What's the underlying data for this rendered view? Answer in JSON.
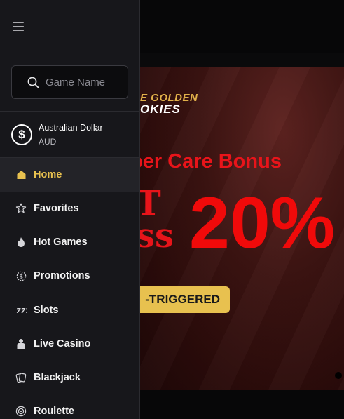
{
  "search": {
    "placeholder": "Game Name"
  },
  "currency": {
    "name": "Australian Dollar",
    "code": "AUD",
    "symbol": "$"
  },
  "menu_primary": [
    {
      "label": "Home",
      "icon": "home-icon",
      "active": true
    },
    {
      "label": "Favorites",
      "icon": "star-icon"
    },
    {
      "label": "Hot Games",
      "icon": "flame-icon"
    },
    {
      "label": "Promotions",
      "icon": "dollar-badge-icon"
    }
  ],
  "menu_games": [
    {
      "label": "Slots",
      "icon": "slots-icon"
    },
    {
      "label": "Live Casino",
      "icon": "live-casino-icon"
    },
    {
      "label": "Blackjack",
      "icon": "cards-icon"
    },
    {
      "label": "Roulette",
      "icon": "roulette-icon"
    }
  ],
  "banner": {
    "logo_line1": "E GOLDEN",
    "logo_line2": "OKIES",
    "heading": "ber Care  Bonus",
    "big_left_line1": "T",
    "big_left_line2": "ss",
    "big_value": "20%",
    "pill": "-TRIGGERED"
  },
  "colors": {
    "accent": "#e8c14f",
    "banner_red": "#f00a0a",
    "sidebar_bg": "#17171b"
  }
}
